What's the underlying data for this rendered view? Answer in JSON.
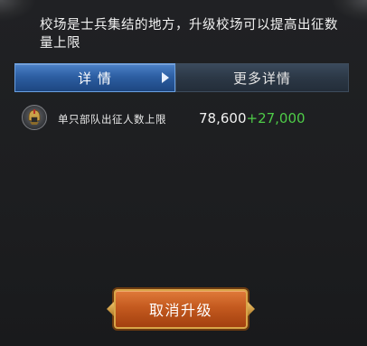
{
  "description": "校场是士兵集结的地方，升级校场可以提高出征数量上限",
  "tabs": [
    {
      "label": "详 情",
      "active": true
    },
    {
      "label": "更多详情",
      "active": false
    }
  ],
  "stat": {
    "icon": "helmet-medal-icon",
    "label": "单只部队出征人数上限",
    "value": "78,600",
    "bonus": "+27,000"
  },
  "button": {
    "label": "取消升级"
  },
  "colors": {
    "tab_active": "#3a6eb3",
    "bonus_green": "#4ecb48",
    "button_orange": "#c45a1f",
    "button_border_gold": "#d9a548"
  }
}
